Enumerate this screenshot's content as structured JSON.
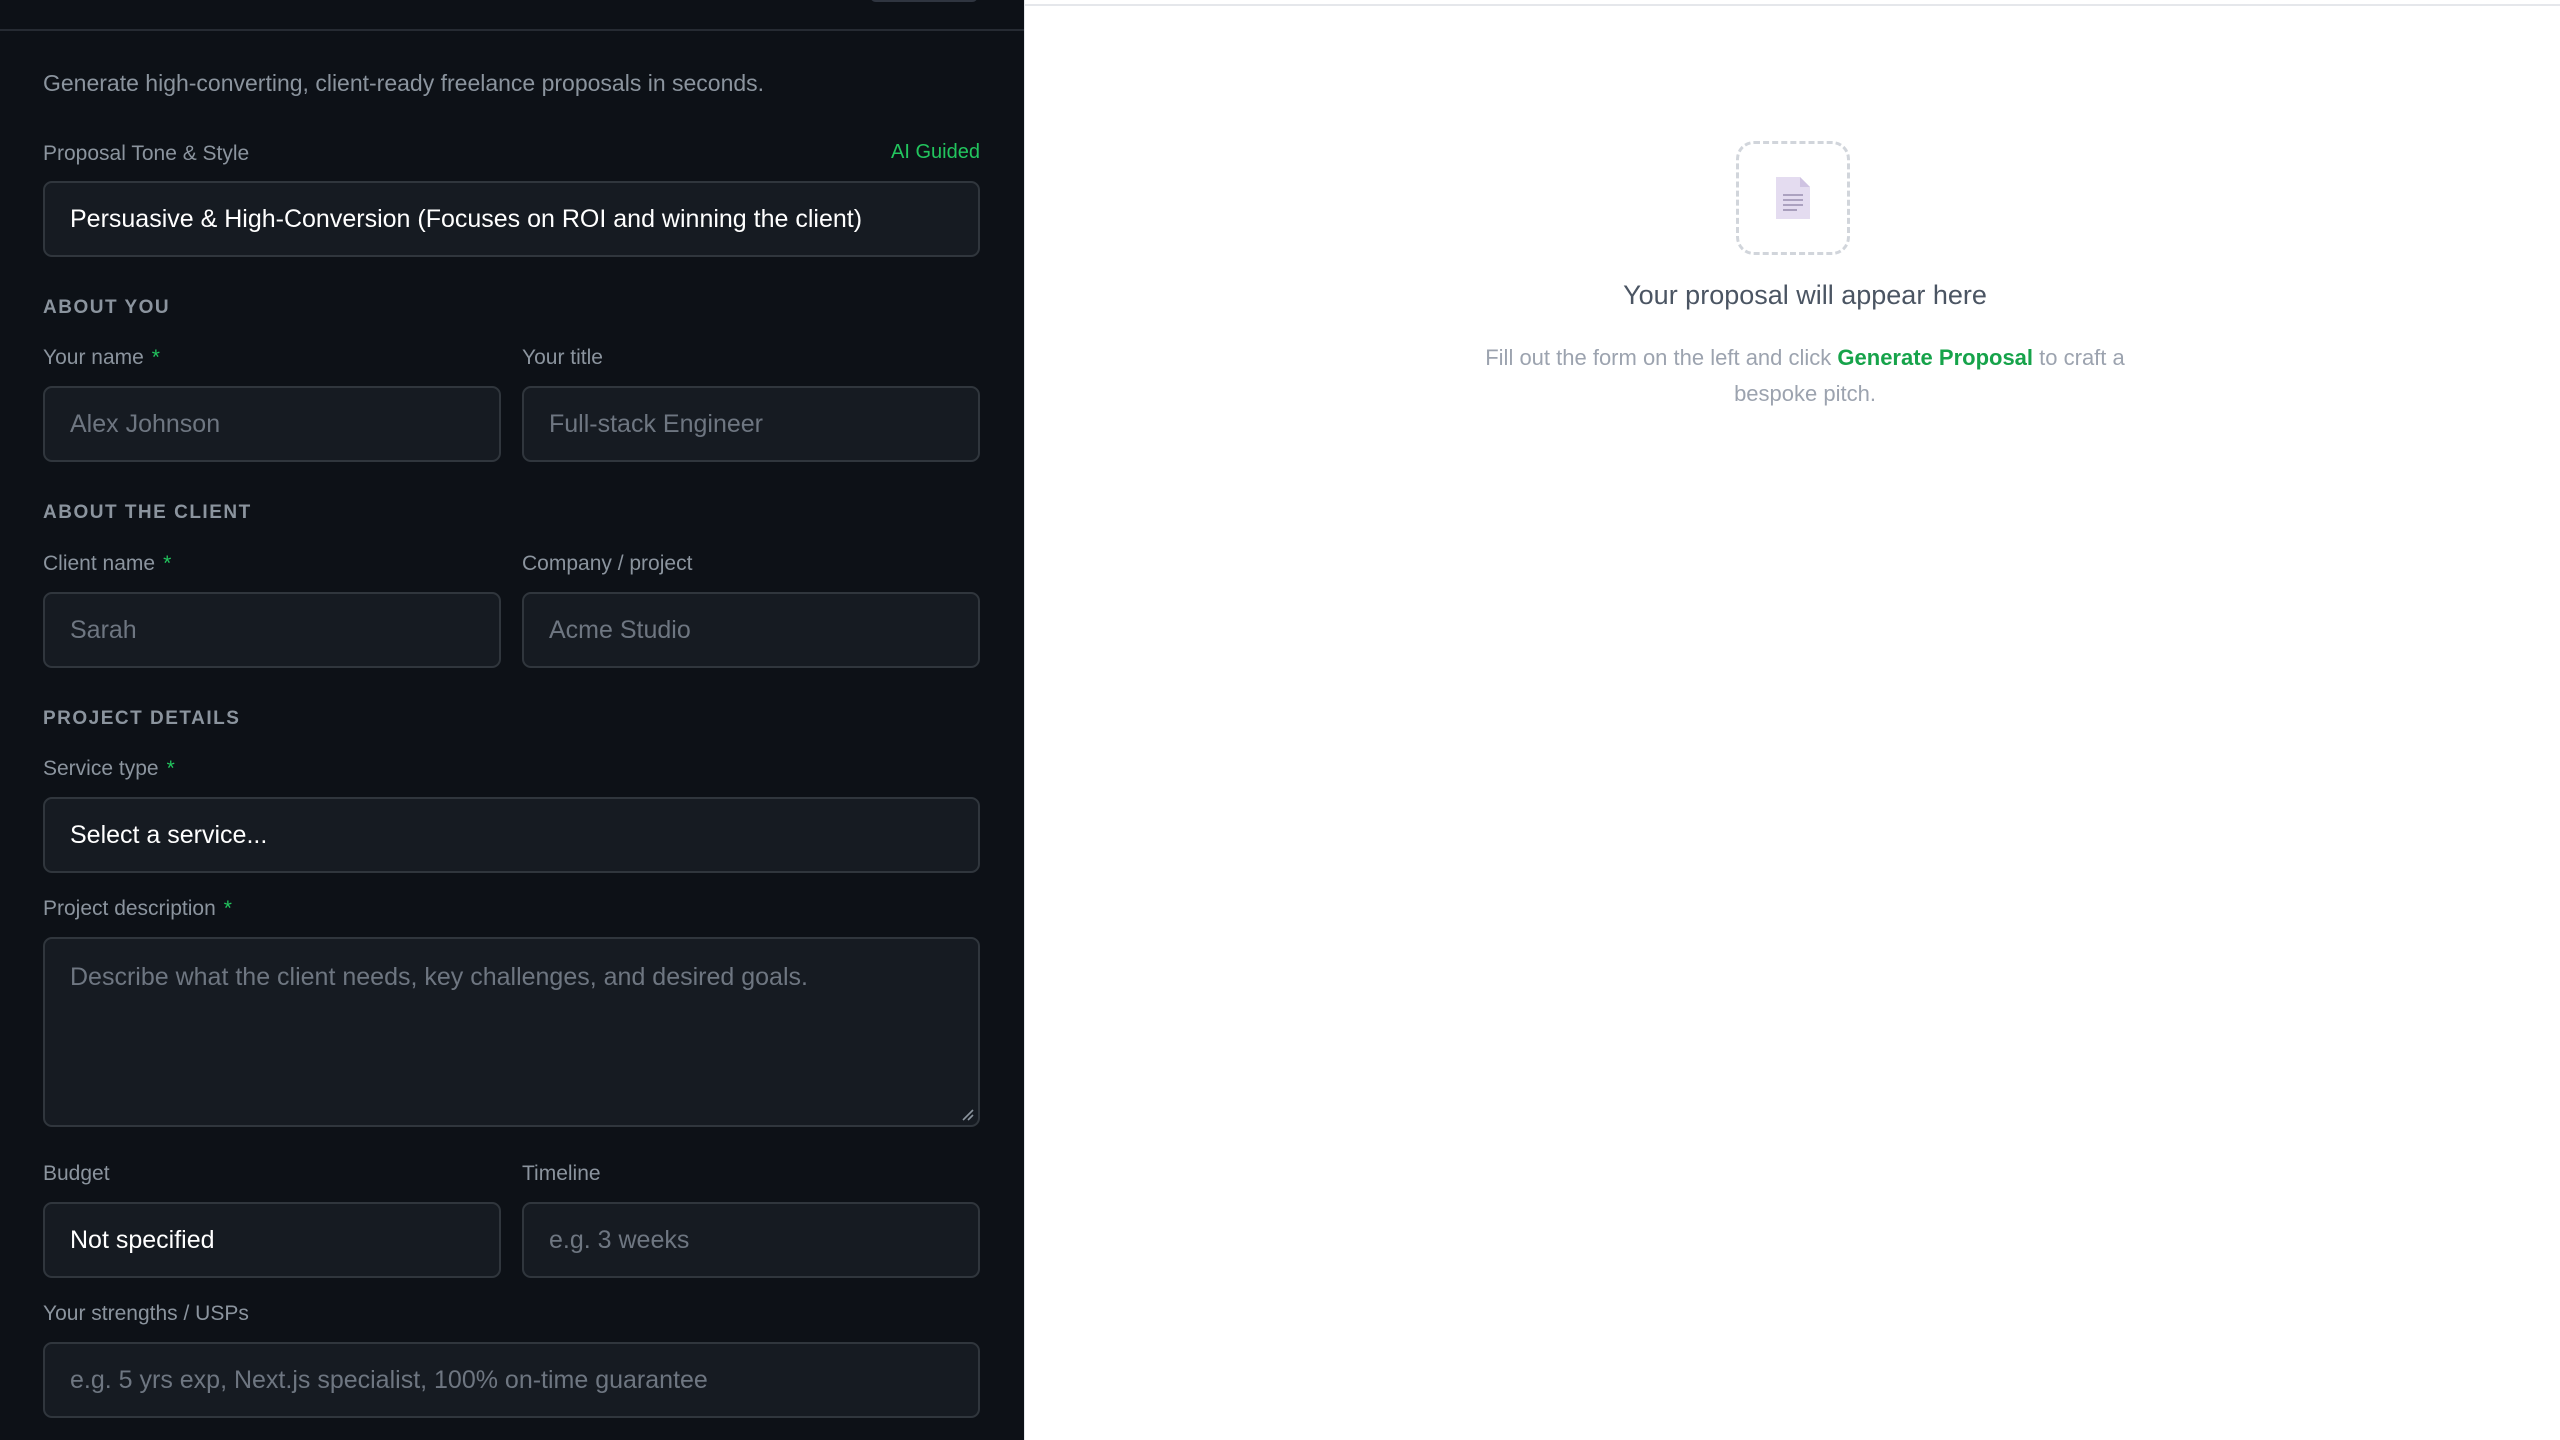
{
  "form": {
    "tagline": "Generate high-converting, client-ready freelance proposals in seconds.",
    "tone": {
      "label": "Proposal Tone & Style",
      "badge": "AI Guided",
      "value": "Persuasive & High-Conversion (Focuses on ROI and winning the client)"
    },
    "required_marker": "*",
    "about_you": {
      "heading": "ABOUT YOU",
      "name_label": "Your name",
      "name_placeholder": "Alex Johnson",
      "title_label": "Your title",
      "title_placeholder": "Full-stack Engineer"
    },
    "about_client": {
      "heading": "ABOUT THE CLIENT",
      "client_label": "Client name",
      "client_placeholder": "Sarah",
      "company_label": "Company / project",
      "company_placeholder": "Acme Studio"
    },
    "project": {
      "heading": "PROJECT DETAILS",
      "service_label": "Service type",
      "service_value": "Select a service...",
      "description_label": "Project description",
      "description_placeholder": "Describe what the client needs, key challenges, and desired goals.",
      "budget_label": "Budget",
      "budget_value": "Not specified",
      "timeline_label": "Timeline",
      "timeline_placeholder": "e.g. 3 weeks",
      "strengths_label": "Your strengths / USPs",
      "strengths_placeholder": "e.g. 5 yrs exp, Next.js specialist, 100% on-time guarantee"
    }
  },
  "preview": {
    "empty_icon": "document-icon",
    "title": "Your proposal will appear here",
    "text_before": "Fill out the form on the left and click ",
    "cta": "Generate Proposal",
    "text_after": " to craft a bespoke pitch."
  },
  "colors": {
    "panel_bg": "#0d1117",
    "field_bg": "#161b22",
    "accent": "#22c55e",
    "cta": "#16a34a"
  }
}
